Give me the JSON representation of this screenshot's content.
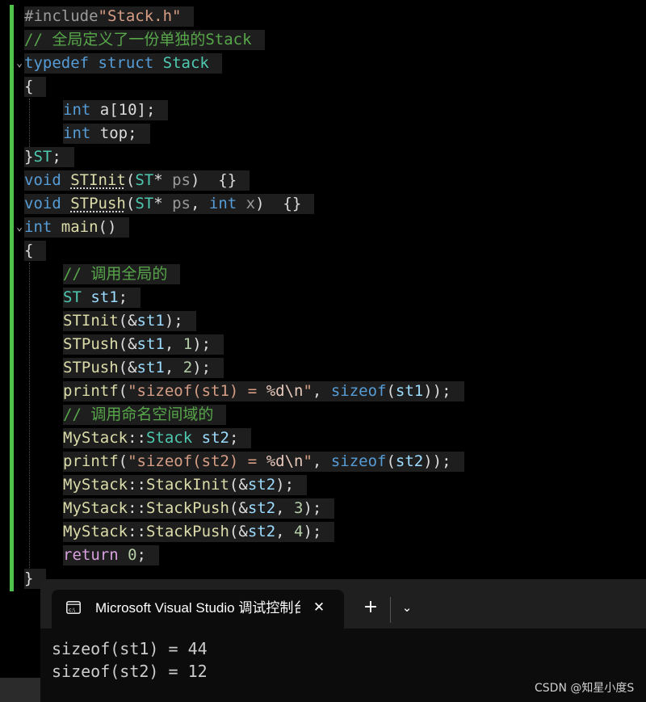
{
  "editor": {
    "lines": [
      {
        "parts": [
          {
            "t": "#include",
            "c": "pp"
          },
          {
            "t": "\"Stack.h\"",
            "c": "str"
          }
        ]
      },
      {
        "parts": [
          {
            "t": "// 全局定义了一份单独的Stack",
            "c": "cm"
          }
        ]
      },
      {
        "parts": [
          {
            "t": "typedef",
            "c": "kw"
          },
          {
            "t": " "
          },
          {
            "t": "struct",
            "c": "kw"
          },
          {
            "t": " "
          },
          {
            "t": "Stack",
            "c": "ty"
          }
        ]
      },
      {
        "parts": [
          {
            "t": "{"
          }
        ]
      },
      {
        "parts": [
          {
            "t": "int",
            "c": "kw"
          },
          {
            "t": " a[10];"
          }
        ]
      },
      {
        "parts": [
          {
            "t": "int",
            "c": "kw"
          },
          {
            "t": " top;"
          }
        ]
      },
      {
        "parts": [
          {
            "t": "}"
          },
          {
            "t": "ST",
            "c": "ty"
          },
          {
            "t": ";"
          }
        ]
      },
      {
        "parts": [
          {
            "t": "void",
            "c": "kw"
          },
          {
            "t": " "
          },
          {
            "t": "STInit",
            "c": "fn dot"
          },
          {
            "t": "("
          },
          {
            "t": "ST",
            "c": "ty"
          },
          {
            "t": "* "
          },
          {
            "t": "ps",
            "c": "par"
          },
          {
            "t": ")  {}"
          }
        ]
      },
      {
        "parts": [
          {
            "t": "void",
            "c": "kw"
          },
          {
            "t": " "
          },
          {
            "t": "STPush",
            "c": "fn dot"
          },
          {
            "t": "("
          },
          {
            "t": "ST",
            "c": "ty"
          },
          {
            "t": "* "
          },
          {
            "t": "ps",
            "c": "par"
          },
          {
            "t": ", "
          },
          {
            "t": "int",
            "c": "kw"
          },
          {
            "t": " "
          },
          {
            "t": "x",
            "c": "par"
          },
          {
            "t": ")  {}"
          }
        ]
      },
      {
        "parts": [
          {
            "t": "int",
            "c": "kw"
          },
          {
            "t": " "
          },
          {
            "t": "main",
            "c": "fn"
          },
          {
            "t": "()"
          }
        ]
      },
      {
        "parts": [
          {
            "t": "{"
          }
        ]
      },
      {
        "parts": [
          {
            "t": "// 调用全局的",
            "c": "cm"
          }
        ]
      },
      {
        "parts": [
          {
            "t": "ST",
            "c": "ty"
          },
          {
            "t": " "
          },
          {
            "t": "st1",
            "c": "var"
          },
          {
            "t": ";"
          }
        ]
      },
      {
        "parts": [
          {
            "t": "STInit",
            "c": "fn"
          },
          {
            "t": "(&"
          },
          {
            "t": "st1",
            "c": "var"
          },
          {
            "t": ");"
          }
        ]
      },
      {
        "parts": [
          {
            "t": "STPush",
            "c": "fn"
          },
          {
            "t": "(&"
          },
          {
            "t": "st1",
            "c": "var"
          },
          {
            "t": ", "
          },
          {
            "t": "1",
            "c": "num"
          },
          {
            "t": ");"
          }
        ]
      },
      {
        "parts": [
          {
            "t": "STPush",
            "c": "fn"
          },
          {
            "t": "(&"
          },
          {
            "t": "st1",
            "c": "var"
          },
          {
            "t": ", "
          },
          {
            "t": "2",
            "c": "num"
          },
          {
            "t": ");"
          }
        ]
      },
      {
        "parts": [
          {
            "t": "printf",
            "c": "fn"
          },
          {
            "t": "("
          },
          {
            "t": "\"sizeof(st1) = ",
            "c": "str"
          },
          {
            "t": "%d",
            "c": "esc"
          },
          {
            "t": "\\n",
            "c": "esc"
          },
          {
            "t": "\"",
            "c": "str"
          },
          {
            "t": ", "
          },
          {
            "t": "sizeof",
            "c": "kw"
          },
          {
            "t": "("
          },
          {
            "t": "st1",
            "c": "var"
          },
          {
            "t": "));"
          }
        ]
      },
      {
        "parts": [
          {
            "t": "// 调用命名空间域的",
            "c": "cm"
          }
        ]
      },
      {
        "parts": [
          {
            "t": "MyStack",
            "c": "fn"
          },
          {
            "t": "::"
          },
          {
            "t": "Stack",
            "c": "ty"
          },
          {
            "t": " "
          },
          {
            "t": "st2",
            "c": "var"
          },
          {
            "t": ";"
          }
        ]
      },
      {
        "parts": [
          {
            "t": "printf",
            "c": "fn"
          },
          {
            "t": "("
          },
          {
            "t": "\"sizeof(st2) = ",
            "c": "str"
          },
          {
            "t": "%d",
            "c": "esc"
          },
          {
            "t": "\\n",
            "c": "esc"
          },
          {
            "t": "\"",
            "c": "str"
          },
          {
            "t": ", "
          },
          {
            "t": "sizeof",
            "c": "kw"
          },
          {
            "t": "("
          },
          {
            "t": "st2",
            "c": "var"
          },
          {
            "t": "));"
          }
        ]
      },
      {
        "parts": [
          {
            "t": "MyStack",
            "c": "fn"
          },
          {
            "t": "::"
          },
          {
            "t": "StackInit",
            "c": "fn"
          },
          {
            "t": "(&"
          },
          {
            "t": "st2",
            "c": "var"
          },
          {
            "t": ");"
          }
        ]
      },
      {
        "parts": [
          {
            "t": "MyStack",
            "c": "fn"
          },
          {
            "t": "::"
          },
          {
            "t": "StackPush",
            "c": "fn"
          },
          {
            "t": "(&"
          },
          {
            "t": "st2",
            "c": "var"
          },
          {
            "t": ", "
          },
          {
            "t": "3",
            "c": "num"
          },
          {
            "t": ");"
          }
        ]
      },
      {
        "parts": [
          {
            "t": "MyStack",
            "c": "fn"
          },
          {
            "t": "::"
          },
          {
            "t": "StackPush",
            "c": "fn"
          },
          {
            "t": "(&"
          },
          {
            "t": "st2",
            "c": "var"
          },
          {
            "t": ", "
          },
          {
            "t": "4",
            "c": "num"
          },
          {
            "t": ");"
          }
        ]
      },
      {
        "parts": [
          {
            "t": "return",
            "c": "ctl"
          },
          {
            "t": " "
          },
          {
            "t": "0",
            "c": "num"
          },
          {
            "t": ";"
          }
        ]
      },
      {
        "parts": [
          {
            "t": "}"
          }
        ]
      }
    ]
  },
  "console": {
    "tab": {
      "icon": "console-app-icon",
      "title": "Microsoft Visual Studio 调试控制台"
    },
    "close_symbol": "✕",
    "new_tab_symbol": "+",
    "dropdown_symbol": "⌄",
    "output": [
      "sizeof(st1) = 44",
      "sizeof(st2) = 12"
    ]
  },
  "watermark": "CSDN @知星小度S",
  "colors": {
    "editor_bg": "#000000",
    "line_bg": "#1e1e1e",
    "change_bar": "#4ec24a",
    "keyword": "#569cd6",
    "type": "#4ec9b0",
    "string": "#d69d85",
    "comment": "#57a64a",
    "function": "#dcdcaa",
    "variable": "#9cdcfe",
    "number": "#b5cea8"
  }
}
